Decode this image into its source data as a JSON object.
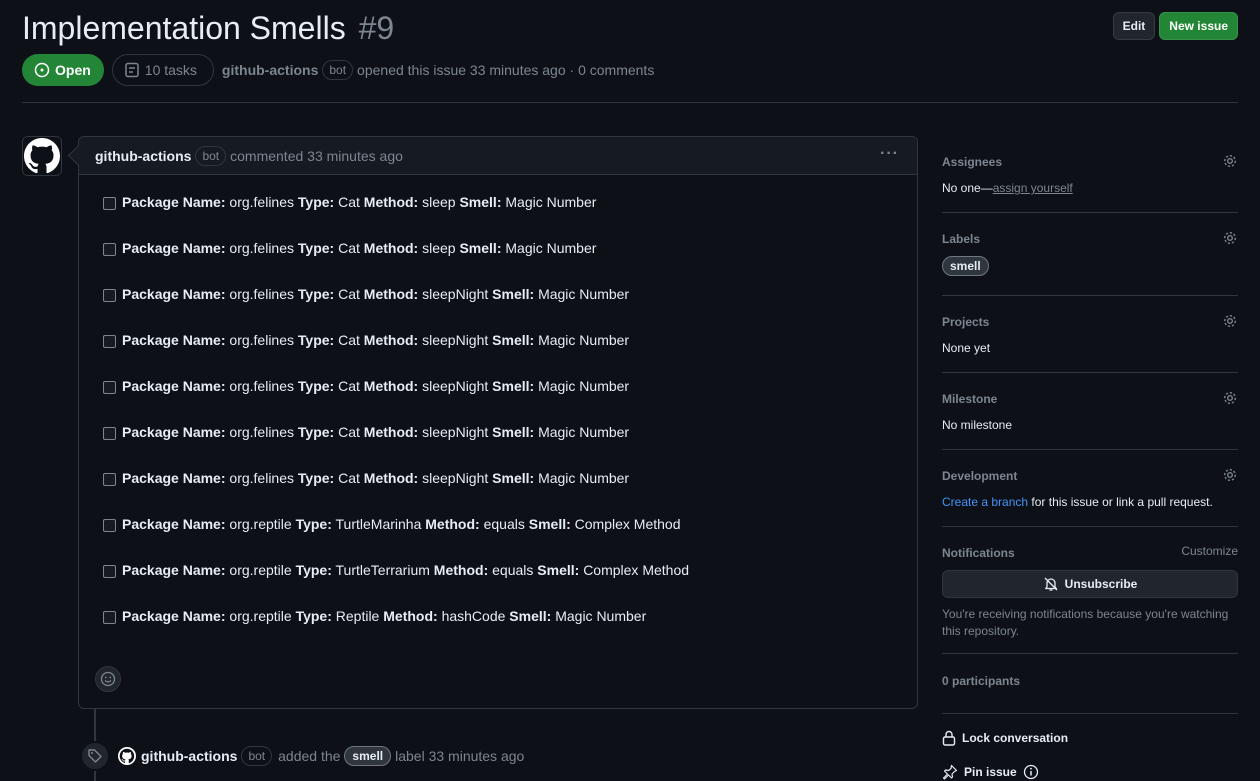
{
  "issue": {
    "title": "Implementation Smells",
    "number": "#9",
    "state": "Open",
    "tasks": "10 tasks",
    "author": "github-actions",
    "bot_tag": "bot",
    "opened_text": "opened this issue 33 minutes ago · 0 comments"
  },
  "header_actions": {
    "edit": "Edit",
    "new_issue": "New issue"
  },
  "comment": {
    "author": "github-actions",
    "bot_tag": "bot",
    "time": "commented 33 minutes ago",
    "tasks": [
      {
        "package": "org.felines",
        "type": "Cat",
        "method": "sleep",
        "smell": "Magic Number"
      },
      {
        "package": "org.felines",
        "type": "Cat",
        "method": "sleep",
        "smell": "Magic Number"
      },
      {
        "package": "org.felines",
        "type": "Cat",
        "method": "sleepNight",
        "smell": "Magic Number"
      },
      {
        "package": "org.felines",
        "type": "Cat",
        "method": "sleepNight",
        "smell": "Magic Number"
      },
      {
        "package": "org.felines",
        "type": "Cat",
        "method": "sleepNight",
        "smell": "Magic Number"
      },
      {
        "package": "org.felines",
        "type": "Cat",
        "method": "sleepNight",
        "smell": "Magic Number"
      },
      {
        "package": "org.felines",
        "type": "Cat",
        "method": "sleepNight",
        "smell": "Magic Number"
      },
      {
        "package": "org.reptile",
        "type": "TurtleMarinha",
        "method": "equals",
        "smell": "Complex Method"
      },
      {
        "package": "org.reptile",
        "type": "TurtleTerrarium",
        "method": "equals",
        "smell": "Complex Method"
      },
      {
        "package": "org.reptile",
        "type": "Reptile",
        "method": "hashCode",
        "smell": "Magic Number"
      }
    ],
    "field_labels": {
      "package": "Package Name:",
      "type": "Type:",
      "method": "Method:",
      "smell": "Smell:"
    }
  },
  "timeline_event": {
    "author": "github-actions",
    "bot_tag": "bot",
    "action": "added the",
    "label": "smell",
    "suffix": "label 33 minutes ago"
  },
  "sidebar": {
    "assignees": {
      "heading": "Assignees",
      "value_prefix": "No one—",
      "link": "assign yourself"
    },
    "labels": {
      "heading": "Labels",
      "label": "smell"
    },
    "projects": {
      "heading": "Projects",
      "value": "None yet"
    },
    "milestone": {
      "heading": "Milestone",
      "value": "No milestone"
    },
    "development": {
      "heading": "Development",
      "link": "Create a branch",
      "suffix": " for this issue or link a pull request."
    },
    "notifications": {
      "heading": "Notifications",
      "customize": "Customize",
      "button": "Unsubscribe",
      "text": "You're receiving notifications because you're watching this repository."
    },
    "participants": "0 participants",
    "lock": "Lock conversation",
    "pin": "Pin issue"
  },
  "colors": {
    "background": "#0d1117",
    "border": "#30363d",
    "muted": "#7d8590",
    "text": "#e6edf3",
    "open_green": "#238636",
    "accent_link": "#4493f8"
  }
}
